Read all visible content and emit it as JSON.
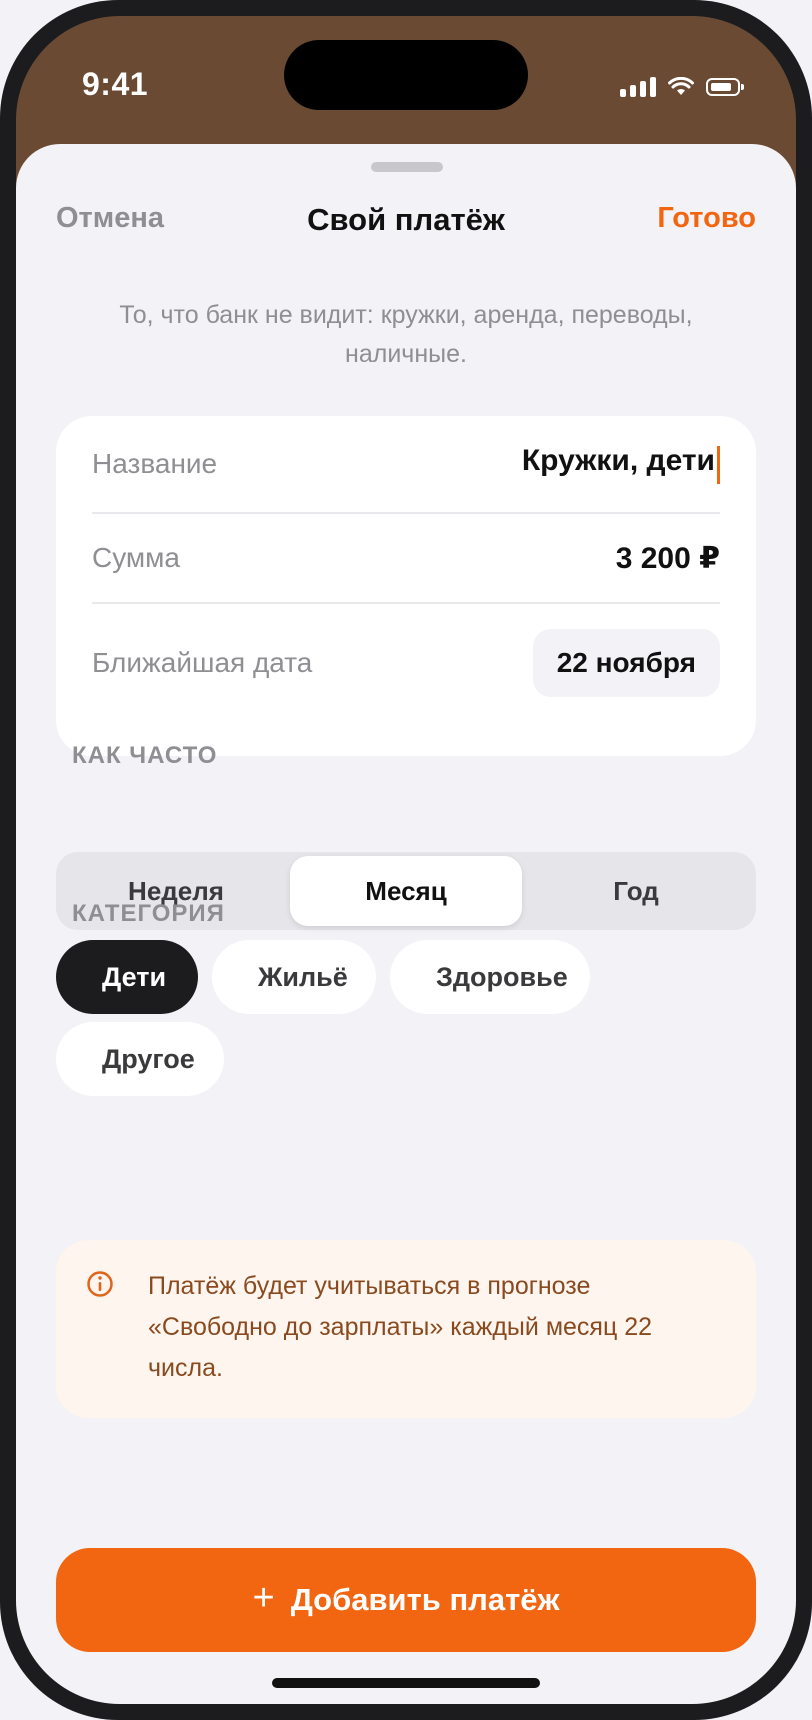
{
  "status_bar": {
    "time": "9:41"
  },
  "nav": {
    "cancel_label": "Отмена",
    "title": "Свой платёж",
    "done_label": "Готово"
  },
  "subtitle": "То, что банк не видит: кружки, аренда, переводы, наличные.",
  "form": {
    "name_label": "Название",
    "name_value": "Кружки, дети",
    "amount_label": "Сумма",
    "amount_value": "3 200 ₽",
    "date_label": "Ближайшая дата",
    "date_value": "22 ноября"
  },
  "frequency": {
    "section_label": "КАК ЧАСТО",
    "options": [
      "Неделя",
      "Месяц",
      "Год"
    ],
    "selected": "Месяц"
  },
  "category": {
    "section_label": "КАТЕГОРИЯ",
    "chips": [
      {
        "label": "Дети",
        "color": "#ff2d55",
        "selected": true
      },
      {
        "label": "Жильё",
        "color": "#34c759",
        "selected": false
      },
      {
        "label": "Здоровье",
        "color": "#0a84ff",
        "selected": false
      },
      {
        "label": "Другое",
        "color": "#8e8e93",
        "selected": false
      }
    ]
  },
  "notice": {
    "icon": "info-icon",
    "text": "Платёж будет учитываться в прогнозе «Свободно до зарплаты» каждый месяц 22 числа."
  },
  "cta": {
    "icon": "plus-icon",
    "label": "Добавить платёж"
  },
  "colors": {
    "accent": "#f26511",
    "header_bg": "#6b4a34",
    "sheet_bg": "#f2f2f7"
  }
}
